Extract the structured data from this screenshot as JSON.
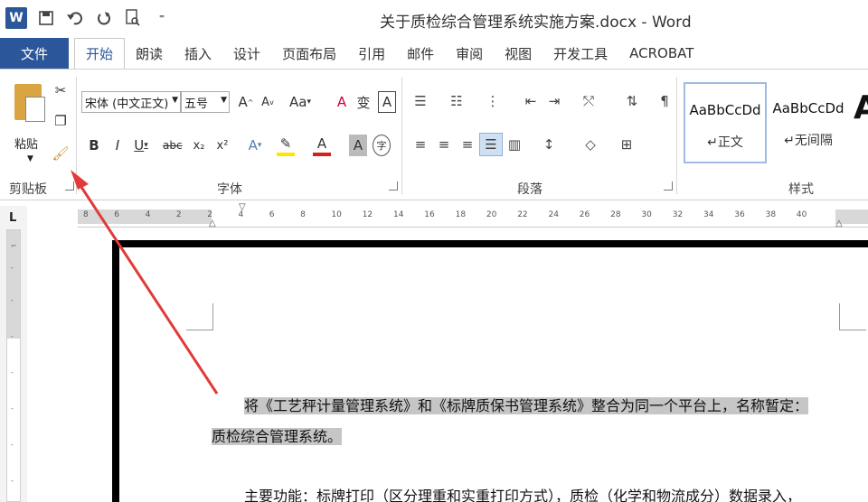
{
  "titlebar": {
    "app_icon": "W",
    "title": "关于质检综合管理系统实施方案.docx - Word",
    "qat_icons": [
      "save-icon",
      "undo-icon",
      "redo-icon",
      "print-preview-icon"
    ]
  },
  "tabs": {
    "file": "文件",
    "items": [
      "开始",
      "朗读",
      "插入",
      "设计",
      "页面布局",
      "引用",
      "邮件",
      "审阅",
      "视图",
      "开发工具",
      "ACROBAT"
    ],
    "active": "开始"
  },
  "ribbon": {
    "clipboard": {
      "paste_label": "粘贴",
      "group_label": "剪贴板"
    },
    "font": {
      "font_name": "宋体 (中文正文)",
      "font_size": "五号",
      "group_label": "字体",
      "buttons": [
        "A",
        "A",
        "Aa",
        "A",
        "B",
        "I",
        "U",
        "abc",
        "x₂",
        "x²",
        "A",
        "A",
        "A",
        "字"
      ]
    },
    "paragraph": {
      "group_label": "段落"
    },
    "styles": {
      "group_label": "样式",
      "items": [
        {
          "sample": "AaBbCcDd",
          "name": "正文",
          "selected": true
        },
        {
          "sample": "AaBbCcDd",
          "name": "无间隔",
          "selected": false
        }
      ]
    }
  },
  "ruler": {
    "labels": [
      "8",
      "6",
      "4",
      "2",
      "2",
      "4",
      "6",
      "8",
      "10",
      "12",
      "14",
      "16",
      "18",
      "20",
      "22",
      "24",
      "26",
      "28",
      "30",
      "32",
      "34",
      "36",
      "38",
      "40"
    ],
    "corner": "L"
  },
  "document": {
    "line1": "将《工艺秤计量管理系统》和《标牌质保书管理系统》整合为同一个平台上，名称暂定：",
    "line2": "质检综合管理系统。",
    "line3": "主要功能：标牌打印（区分理重和实重打印方式），质检（化学和物流成分）数据录入，"
  },
  "colors": {
    "accent": "#2b579a",
    "highlight": "#c6c6c6",
    "annotation": "#e23a3a"
  }
}
